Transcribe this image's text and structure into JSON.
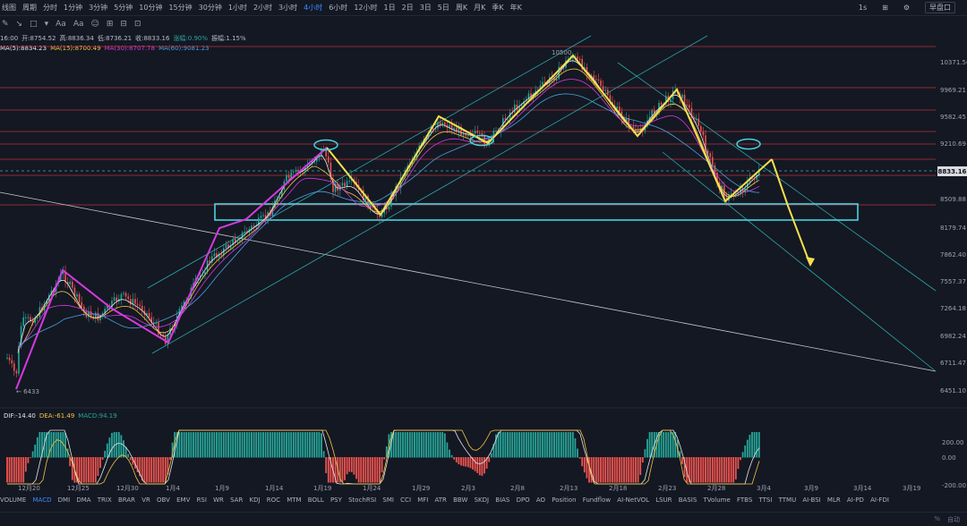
{
  "topbar": {
    "left_items": [
      "线图",
      "周期",
      "分时",
      "1分钟",
      "3分钟",
      "5分钟",
      "10分钟",
      "15分钟",
      "30分钟",
      "1小时",
      "2小时",
      "3小时",
      "4小时",
      "6小时",
      "12小时",
      "1日",
      "2日",
      "3日",
      "5日",
      "周K",
      "月K",
      "季K",
      "年K"
    ],
    "active_item": "4小时",
    "right_label": "1s",
    "right_button": "早盘口"
  },
  "tools": [
    "✎",
    "↘",
    "□",
    "▾",
    "Aa",
    "Aa",
    "☺",
    "⊞",
    "⊟",
    "⊡"
  ],
  "ohlc": {
    "time": "16:00",
    "open": "开:8754.52",
    "high": "高:8836.34",
    "low": "低:8736.21",
    "close": "收:8833.16",
    "change": "涨幅:0.90%",
    "amplitude": "振幅:1.15%"
  },
  "ma_legend": {
    "ma5": "MA(5):8834.23",
    "ma15": "MA(15):8700.49",
    "ma30": "MA(30):8707.78",
    "ma60": "MA(60):9081.23"
  },
  "price_axis": [
    "10371.56",
    "9969.21",
    "9582.45",
    "9210.69",
    "8833.16",
    "8509.88",
    "8179.74",
    "7862.40",
    "7557.37",
    "7264.18",
    "6982.24",
    "6711.47",
    "6451.10"
  ],
  "last_price": "8833.16",
  "high_label": "10500",
  "low_label": "← 6433",
  "macd_legend": {
    "dif": "DIF:-14.40",
    "dea": "DEA:-61.49",
    "macd": "MACD:94.19"
  },
  "macd_axis": [
    "200.00",
    "0.00",
    "-200.00"
  ],
  "date_axis": [
    "12月20",
    "12月25",
    "12月30",
    "1月4",
    "1月9",
    "1月14",
    "1月19",
    "1月24",
    "1月29",
    "2月3",
    "2月8",
    "2月13",
    "2月18",
    "2月23",
    "2月28",
    "3月4",
    "3月9",
    "3月14",
    "3月19"
  ],
  "indicator_tabs": [
    "VOLUME",
    "MACD",
    "DMI",
    "DMA",
    "TRIX",
    "BRAR",
    "VR",
    "OBV",
    "EMV",
    "RSI",
    "WR",
    "SAR",
    "KDJ",
    "ROC",
    "MTM",
    "BOLL",
    "PSY",
    "StochRSI",
    "SMI",
    "CCI",
    "MFI",
    "ATR",
    "BBW",
    "SKDJ",
    "BIAS",
    "DPO",
    "AO",
    "Position",
    "Fundflow",
    "AI-NetVOL",
    "LSUR",
    "BASIS",
    "TVolume",
    "FTBS",
    "TTSI",
    "TTMU",
    "AI-BSI",
    "MLR",
    "AI-PD",
    "AI-FDI"
  ],
  "indicator_selected": "MACD",
  "statusbar": {
    "right": [
      "%",
      "自动"
    ]
  },
  "colors": {
    "bg": "#141823",
    "up": "#26a69a",
    "down": "#ef5350",
    "magenta": "#d63adf",
    "yellow": "#f4e04d",
    "cyan": "#46c9d8",
    "red_line": "#b8323a"
  }
}
